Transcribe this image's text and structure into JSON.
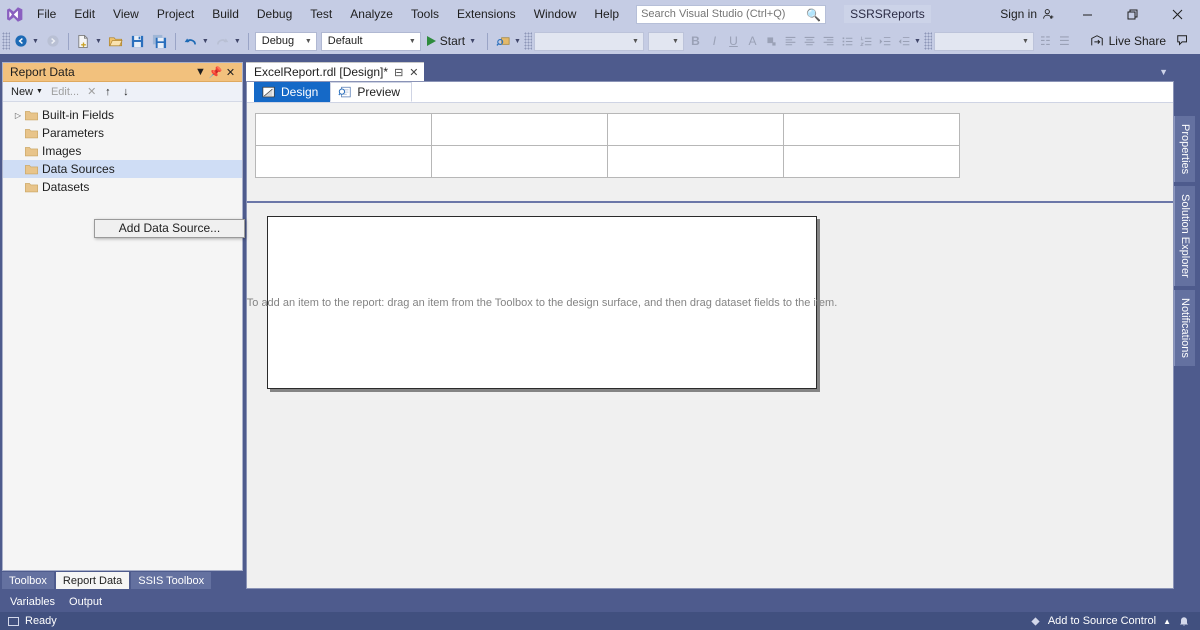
{
  "titlebar": {
    "logo_icon": "visual-studio-logo",
    "menus": [
      "File",
      "Edit",
      "View",
      "Project",
      "Build",
      "Debug",
      "Test",
      "Analyze",
      "Tools",
      "Extensions",
      "Window",
      "Help"
    ],
    "search_placeholder": "Search Visual Studio (Ctrl+Q)",
    "search_value": "",
    "search_icon": "search-icon",
    "project_name": "SSRSReports",
    "sign_in_label": "Sign in",
    "sign_in_icon": "person-add-icon",
    "minimize_icon": "minimize-icon",
    "restore_icon": "restore-icon",
    "close_icon": "close-icon"
  },
  "toolbar": {
    "navigate_back_icon": "navigate-back-icon",
    "navigate_forward_icon": "navigate-forward-icon",
    "new_item_icon": "new-item-icon",
    "open_file_icon": "open-file-icon",
    "save_icon": "save-icon",
    "save_all_icon": "save-all-icon",
    "undo_icon": "undo-icon",
    "redo_icon": "redo-icon",
    "config_value": "Debug",
    "platform_value": "Default",
    "start_label": "Start",
    "start_icon": "run-triangle-icon",
    "attach_icon": "attach-process-icon",
    "font_family_value": "",
    "font_size_value": "",
    "bold_label": "B",
    "italic_label": "I",
    "underline_label": "U",
    "font_color_label": "A",
    "highlight_icon": "highlight-icon",
    "align_left_icon": "align-left-icon",
    "align_center_icon": "align-center-icon",
    "align_right_icon": "align-right-icon",
    "list_bullet_icon": "bullet-list-icon",
    "list_number_icon": "numbered-list-icon",
    "indent_increase_icon": "indent-increase-icon",
    "indent_decrease_icon": "indent-decrease-icon",
    "style_value": "",
    "live_share_label": "Live Share",
    "live_share_icon": "live-share-icon",
    "feedback_icon": "feedback-icon"
  },
  "report_data": {
    "title": "Report Data",
    "dropdown_icon": "chevron-down-icon",
    "pin_icon": "pin-icon",
    "close_icon": "close-icon",
    "toolbar": {
      "new_label": "New",
      "new_arrow_icon": "chevron-down-icon",
      "edit_label": "Edit...",
      "delete_icon": "delete-x-icon",
      "move_up_icon": "arrow-up-icon",
      "move_down_icon": "arrow-down-icon"
    },
    "tree": [
      {
        "label": "Built-in Fields",
        "expandable": true,
        "selected": false
      },
      {
        "label": "Parameters",
        "expandable": false,
        "selected": false
      },
      {
        "label": "Images",
        "expandable": false,
        "selected": false
      },
      {
        "label": "Data Sources",
        "expandable": false,
        "selected": true
      },
      {
        "label": "Datasets",
        "expandable": false,
        "selected": false
      }
    ],
    "folder_icon": "folder-icon"
  },
  "context_menu": {
    "items": [
      "Add Data Source..."
    ]
  },
  "dock_tabs": {
    "primary": [
      {
        "label": "Toolbox",
        "active": false
      },
      {
        "label": "Report Data",
        "active": true
      },
      {
        "label": "SSIS Toolbox",
        "active": false
      }
    ],
    "secondary": [
      "Variables",
      "Output"
    ]
  },
  "document": {
    "tab_label": "ExcelReport.rdl [Design]*",
    "tab_pin_icon": "pin-icon",
    "tab_close_icon": "close-icon",
    "overflow_icon": "chevron-down-icon",
    "designer_tabs": [
      {
        "label": "Design",
        "icon": "design-ruler-icon",
        "active": true
      },
      {
        "label": "Preview",
        "icon": "preview-magnifier-icon",
        "active": false
      }
    ],
    "grid": {
      "rows": 2,
      "cols": 4,
      "cells": [
        [
          "",
          "",
          "",
          ""
        ],
        [
          "",
          "",
          "",
          ""
        ]
      ]
    },
    "body_hint": "To add an item to the report: drag an item from the Toolbox to the design surface, and then drag dataset fields to the item."
  },
  "side_tabs": [
    "Properties",
    "Solution Explorer",
    "Notifications"
  ],
  "statusbar": {
    "state_icon": "ready-icon",
    "state_label": "Ready",
    "source_control_label": "Add to Source Control",
    "source_control_icon": "source-control-icon",
    "source_control_arrow_icon": "chevron-up-icon",
    "notifications_icon": "bell-icon"
  },
  "colors": {
    "titlebar_bg": "#c5cce4",
    "shell_bg": "#4e5b8d",
    "accent_blue": "#1569c7",
    "panel_header": "#f2c17d",
    "selection": "#cfddf5",
    "statusbar_bg": "#41507f"
  }
}
